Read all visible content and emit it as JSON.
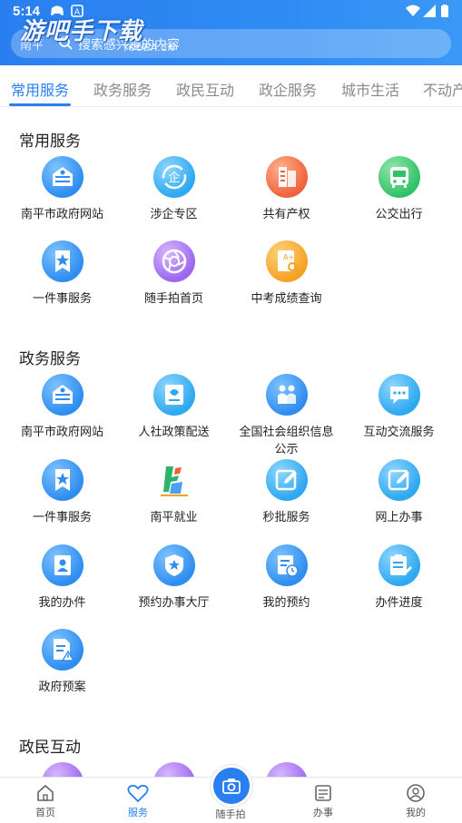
{
  "status": {
    "time": "5:14"
  },
  "watermark": {
    "text": "游吧手下载",
    "sub": "YOUBA.CN"
  },
  "search": {
    "location": "南平",
    "placeholder": "搜索感兴趣的内容"
  },
  "tabs": [
    "常用服务",
    "政务服务",
    "政民互动",
    "政企服务",
    "城市生活",
    "不动产"
  ],
  "sections": {
    "common": {
      "title": "常用服务",
      "items": [
        {
          "label": "南平市政府网站",
          "icon": "government-building-icon"
        },
        {
          "label": "涉企专区",
          "icon": "enterprise-icon"
        },
        {
          "label": "共有产权",
          "icon": "building-icon"
        },
        {
          "label": "公交出行",
          "icon": "bus-icon"
        },
        {
          "label": "一件事服务",
          "icon": "star-bookmark-icon"
        },
        {
          "label": "随手拍首页",
          "icon": "aperture-icon"
        },
        {
          "label": "中考成绩查询",
          "icon": "exam-search-icon"
        }
      ]
    },
    "gov": {
      "title": "政务服务",
      "items": [
        {
          "label": "南平市政府网站",
          "icon": "government-building-icon"
        },
        {
          "label": "人社政策配送",
          "icon": "policy-icon"
        },
        {
          "label": "全国社会组织信息公示",
          "icon": "organization-icon"
        },
        {
          "label": "互动交流服务",
          "icon": "chat-icon"
        },
        {
          "label": "一件事服务",
          "icon": "star-bookmark-icon"
        },
        {
          "label": "南平就业",
          "icon": "employment-logo-icon"
        },
        {
          "label": "秒批服务",
          "icon": "edit-icon"
        },
        {
          "label": "网上办事",
          "icon": "edit-icon"
        },
        {
          "label": "我的办件",
          "icon": "user-card-icon"
        },
        {
          "label": "预约办事大厅",
          "icon": "badge-icon"
        },
        {
          "label": "我的预约",
          "icon": "calendar-clock-icon"
        },
        {
          "label": "办件进度",
          "icon": "clipboard-pen-icon"
        },
        {
          "label": "政府预案",
          "icon": "document-warning-icon"
        }
      ]
    },
    "interaction": {
      "title": "政民互动"
    }
  },
  "bottom_nav": [
    {
      "label": "首页",
      "icon": "home-icon"
    },
    {
      "label": "服务",
      "icon": "heart-icon"
    },
    {
      "label": "随手拍",
      "icon": "camera-icon"
    },
    {
      "label": "办事",
      "icon": "task-list-icon"
    },
    {
      "label": "我的",
      "icon": "profile-icon"
    }
  ],
  "colors": {
    "accent": "#2a7ff0",
    "header": "#2e8bf4"
  }
}
